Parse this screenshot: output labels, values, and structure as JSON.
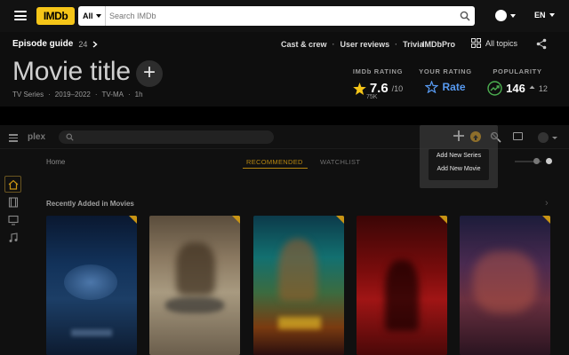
{
  "imdb": {
    "logo_text": "IMDb",
    "search": {
      "category": "All",
      "placeholder": "Search IMDb"
    },
    "language": "EN",
    "episode_guide": {
      "label": "Episode guide",
      "count": "24"
    },
    "top_links": [
      "Cast & crew",
      "User reviews",
      "Trivia"
    ],
    "imdbpro_label": "IMDbPro",
    "all_topics_label": "All topics",
    "title": "Movie title",
    "meta": [
      "TV Series",
      "2019–2022",
      "TV-MA",
      "1h"
    ],
    "imdb_rating": {
      "heading": "IMDb RATING",
      "value": "7.6",
      "scale": "/10",
      "votes": "75K"
    },
    "your_rating": {
      "heading": "YOUR RATING",
      "label": "Rate"
    },
    "popularity": {
      "heading": "POPULARITY",
      "value": "146",
      "delta": "12"
    },
    "colors": {
      "brand_yellow": "#f5c518",
      "rate_blue": "#5799ef",
      "popularity_green": "#4caf50"
    }
  },
  "plex": {
    "logo_text": "plex",
    "breadcrumb": "Home",
    "tabs": [
      {
        "label": "RECOMMENDED",
        "active": true
      },
      {
        "label": "WATCHLIST",
        "active": false
      }
    ],
    "section_title": "Recently Added in Movies",
    "add_menu": {
      "items": [
        "Add New Series",
        "Add New Movie"
      ]
    },
    "posters": [
      {
        "name": "poster-1"
      },
      {
        "name": "poster-2"
      },
      {
        "name": "poster-3"
      },
      {
        "name": "poster-4"
      },
      {
        "name": "poster-5"
      }
    ],
    "colors": {
      "accent": "#e5a00d"
    }
  }
}
